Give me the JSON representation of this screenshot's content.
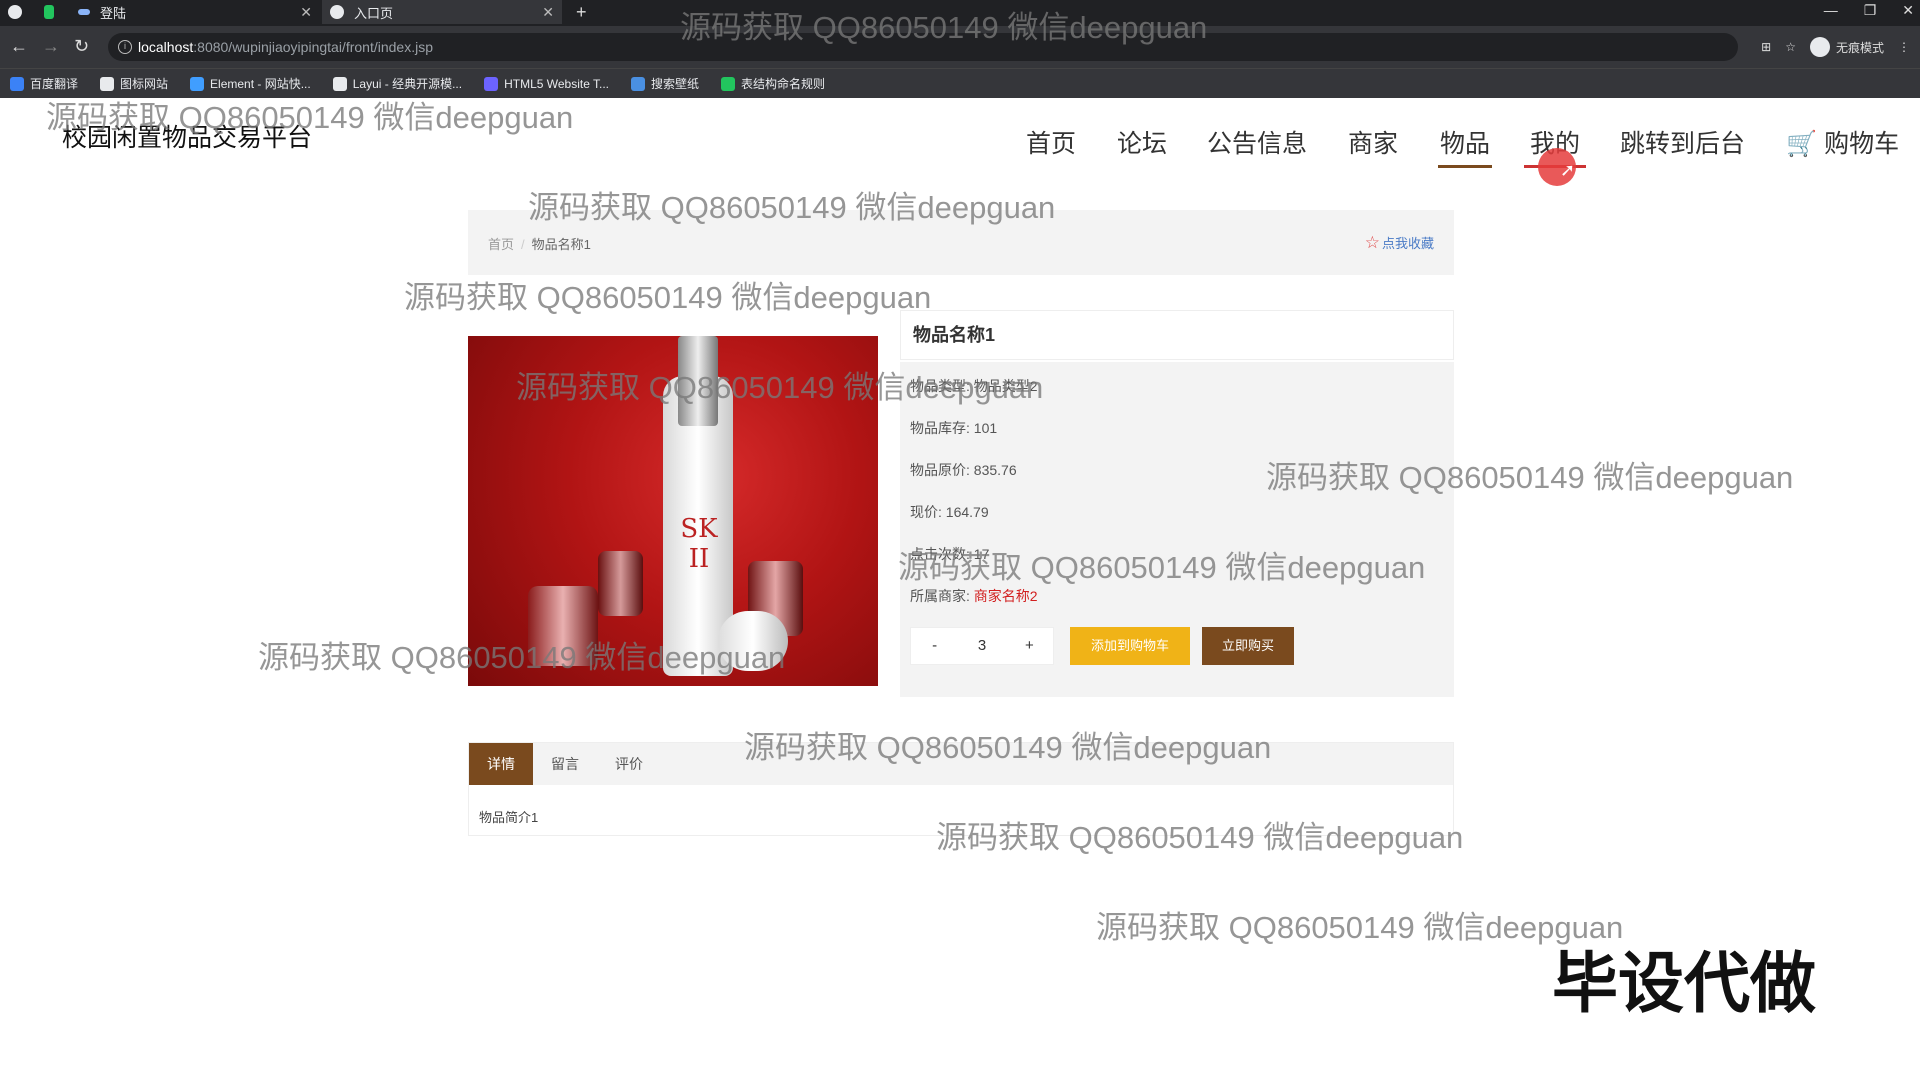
{
  "browser": {
    "tabs": [
      {
        "label": ""
      },
      {
        "label": ""
      },
      {
        "label": "登陆"
      },
      {
        "label": "入口页"
      }
    ],
    "url_host": "localhost",
    "url_path": ":8080/wupinjiaoyipingtai/front/index.jsp",
    "profile_label": "无痕模式",
    "bookmarks": [
      {
        "label": "百度翻译",
        "color": "#3b82f6"
      },
      {
        "label": "图标网站",
        "color": "#e8eaed"
      },
      {
        "label": "Element - 网站快...",
        "color": "#409eff"
      },
      {
        "label": "Layui - 经典开源模...",
        "color": "#e8eaed"
      },
      {
        "label": "HTML5 Website T...",
        "color": "#6c63ff"
      },
      {
        "label": "搜索壁纸",
        "color": "#4a90e2"
      },
      {
        "label": "表结构命名规则",
        "color": "#22c55e"
      }
    ]
  },
  "site": {
    "logo": "校园闲置物品交易平台",
    "nav": [
      "首页",
      "论坛",
      "公告信息",
      "商家",
      "物品",
      "我的",
      "跳转到后台",
      "购物车"
    ]
  },
  "breadcrumb": {
    "home": "首页",
    "sep": "/",
    "current": "物品名称1",
    "favorite": "点我收藏"
  },
  "product": {
    "title": "物品名称1",
    "image_label": "SK-II",
    "type_label": "物品类型:",
    "type_value": "物品类型2",
    "stock_label": "物品库存:",
    "stock_value": "101",
    "orig_price_label": "物品原价:",
    "orig_price_value": "835.76",
    "price_label": "现价:",
    "price_value": "164.79",
    "clicks_label": "点击次数:",
    "clicks_value": "17",
    "merchant_label": "所属商家:",
    "merchant_value": "商家名称2",
    "qty_minus": "-",
    "qty_value": "3",
    "qty_plus": "+",
    "add_cart": "添加到购物车",
    "buy_now": "立即购买"
  },
  "tabs": {
    "items": [
      "详情",
      "留言",
      "评价"
    ],
    "content": "物品简介1"
  },
  "watermark": "源码获取 QQ86050149 微信deepguan",
  "badge": "毕设代做",
  "colors": {
    "brown": "#7a4a1e",
    "orange": "#f0b317",
    "red": "#d21f1f"
  }
}
